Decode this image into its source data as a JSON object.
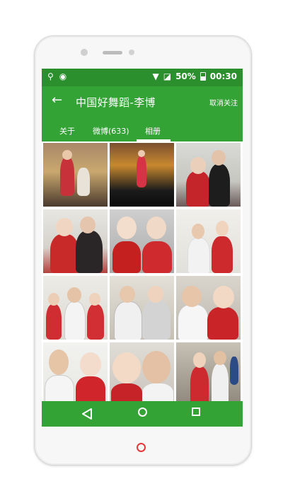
{
  "status_bar": {
    "left_icons": [
      "usb-icon",
      "android-icon"
    ],
    "right_icons": [
      "wifi-icon",
      "no-signal-icon"
    ],
    "battery_percent": "50%",
    "battery_level": 0.5,
    "time": "00:30"
  },
  "app_bar": {
    "title": "中国好舞蹈-李博",
    "action": "取消关注"
  },
  "tabs": [
    {
      "label": "关于"
    },
    {
      "label": "微博(633)"
    },
    {
      "label": "相册",
      "selected": true
    }
  ],
  "colors": {
    "status_bar": "#2c8f2e",
    "app_bar": "#33a336",
    "accent_red": "#d42b2b"
  },
  "photo_grid": {
    "columns": 3,
    "rows": 4,
    "photos": [
      "stage-performance",
      "stage-performance-audience",
      "couple-costume",
      "couple-qipao",
      "women-opera-makeup",
      "couple-red-white",
      "group-costume",
      "group-backstage",
      "couple-closeup",
      "couple-portrait",
      "couple-selfie",
      "dancers-backstage"
    ]
  },
  "nav_bar": {
    "icons": [
      "nav-back-icon",
      "nav-home-icon",
      "nav-recents-icon"
    ]
  }
}
